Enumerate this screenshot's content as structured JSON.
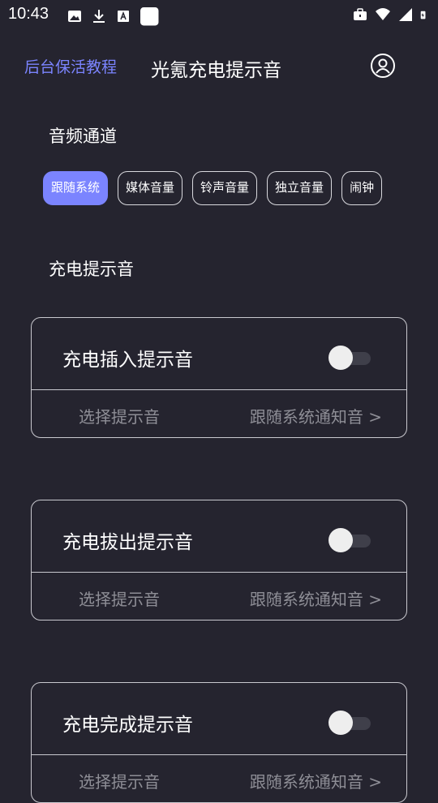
{
  "status_bar": {
    "time": "10:43",
    "left_icons": [
      "image-icon",
      "download-icon",
      "font-icon",
      "square-icon"
    ],
    "right_icons": [
      "briefcase-icon",
      "wifi-icon",
      "signal-icon",
      "battery-charging-icon"
    ]
  },
  "header": {
    "tutorial_link": "后台保活教程",
    "title": "光氪充电提示音",
    "user_icon": "user-icon"
  },
  "audio_channel": {
    "section_title": "音频通道",
    "options": [
      "跟随系统",
      "媒体音量",
      "铃声音量",
      "独立音量",
      "闹钟"
    ],
    "selected": "跟随系统"
  },
  "charge_tones": {
    "section_title": "充电提示音",
    "cards": [
      {
        "label": "充电插入提示音",
        "enabled": false,
        "select_label": "选择提示音",
        "select_value": "跟随系统通知音 >"
      },
      {
        "label": "充电拔出提示音",
        "enabled": false,
        "select_label": "选择提示音",
        "select_value": "跟随系统通知音 >"
      },
      {
        "label": "充电完成提示音",
        "enabled": false,
        "select_label": "选择提示音",
        "select_value": "跟随系统通知音 >"
      }
    ]
  },
  "colors": {
    "background": "#25242f",
    "accent": "#7b84ff",
    "muted_text": "#8e8e96",
    "border": "#c9c9cf"
  }
}
